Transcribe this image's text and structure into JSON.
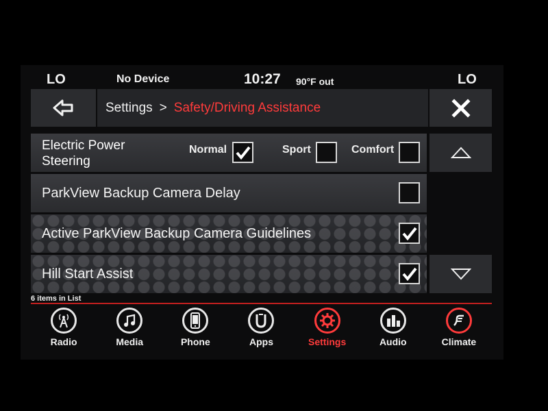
{
  "status": {
    "left_temp": "LO",
    "device": "No Device",
    "time": "10:27",
    "outside_temp": "90°F out",
    "right_temp": "LO"
  },
  "header": {
    "breadcrumb_root": "Settings",
    "breadcrumb_sep": ">",
    "breadcrumb_current": "Safety/Driving Assistance",
    "current_color": "#ff3b3b"
  },
  "list": {
    "rows": [
      {
        "label_line1": "Electric Power",
        "label_line2": "Steering",
        "options": [
          {
            "label": "Normal",
            "checked": true
          },
          {
            "label": "Sport",
            "checked": false
          },
          {
            "label": "Comfort",
            "checked": false
          }
        ]
      },
      {
        "label": "ParkView Backup Camera Delay",
        "checked": false
      },
      {
        "label": "Active ParkView Backup Camera Guidelines",
        "checked": true
      },
      {
        "label": "Hill Start Assist",
        "checked": true
      }
    ],
    "count_text": "6 items in List"
  },
  "nav": {
    "items": [
      {
        "label": "Radio",
        "icon": "radio-tower-icon"
      },
      {
        "label": "Media",
        "icon": "music-note-icon"
      },
      {
        "label": "Phone",
        "icon": "phone-icon"
      },
      {
        "label": "Apps",
        "icon": "apps-icon"
      },
      {
        "label": "Settings",
        "icon": "gear-icon",
        "active": true
      },
      {
        "label": "Audio",
        "icon": "equalizer-icon"
      },
      {
        "label": "Climate",
        "icon": "climate-icon"
      }
    ],
    "active_color": "#ff3b3b"
  }
}
